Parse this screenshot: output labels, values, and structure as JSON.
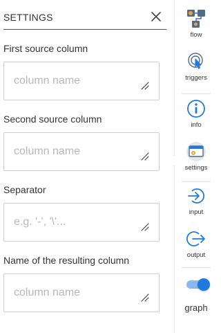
{
  "panel": {
    "title": "SETTINGS",
    "fields": [
      {
        "label": "First source column",
        "placeholder": "column name",
        "value": ""
      },
      {
        "label": "Second source column",
        "placeholder": "column name",
        "value": ""
      },
      {
        "label": "Separator",
        "placeholder": "e.g. '-', '\\'...",
        "value": ""
      },
      {
        "label": "Name of the resulting column",
        "placeholder": "column name",
        "value": ""
      }
    ]
  },
  "sidebar": {
    "items": [
      {
        "label": "flow",
        "icon": "flow-icon"
      },
      {
        "label": "triggers",
        "icon": "triggers-icon"
      },
      {
        "label": "info",
        "icon": "info-icon"
      },
      {
        "label": "settings",
        "icon": "settings-icon",
        "active": true
      },
      {
        "label": "input",
        "icon": "input-icon"
      },
      {
        "label": "output",
        "icon": "output-icon"
      }
    ],
    "graph_toggle": {
      "label": "graph",
      "on": true
    }
  },
  "colors": {
    "accent": "#1f7ae0",
    "accent_light": "#8cb8ef",
    "flow_orange": "#e8a23a",
    "text": "#333333",
    "placeholder": "#b8b8b8",
    "border": "#cfcfcf"
  }
}
